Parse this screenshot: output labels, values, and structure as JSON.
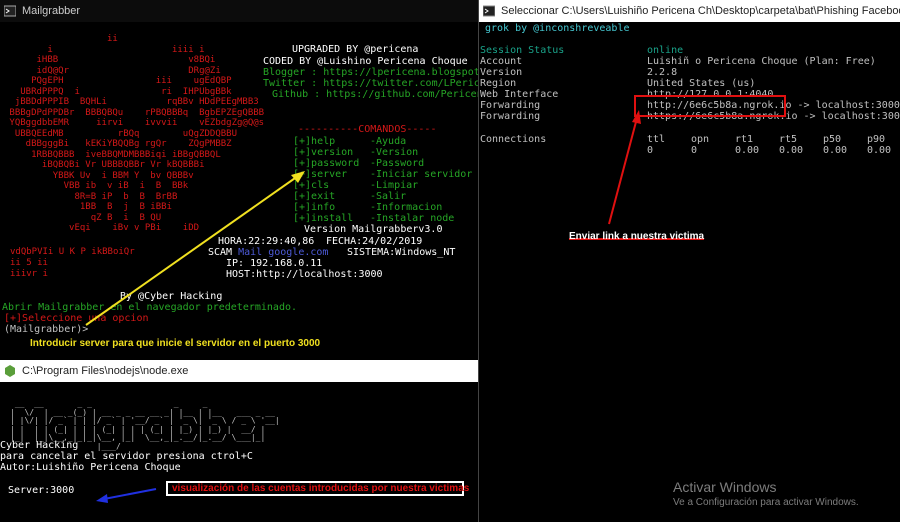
{
  "mailgrabber_window": {
    "title": "Mailgrabber",
    "ascii_art": "                   ii\n        i                      iiii i\n      iHBB                        v8BQi\n      idQ@Qr                      DRg@Zi\n     PQgEPH                 iii    ugEdQBP\n   UBRdPPPQ  i               ri  IHPUbgBBk\n  jBBDdPPPIB  BQHLi           rqBBv HDdPEEgMBB3\n BBBgDPdPPDBr  BBBQBQu    rPBQBBBq  BgbEPZEgQBBB\n YQBggdbbEMR     iirvi    ivvvii    vEZbdgZg@Q@s\n  UBBQEEdMB          rBQq        uQgZDDQBBU\n    dBBgggBi   kEKiYBQQBg rgQr    ZQgPMBBZ\n     1RBBQBBB  iveBBQMDMBBBiqi iBBgQBBQL\n       iBQBQBi Vr UBBBQBBr Vr kBQBBBi\n         YBBK Uv  i BBM Y  bv QBBBv\n           VBB ib  v iB  i  B  BBk\n             8R=B iP  b  B  BrBB\n              1BB  B  j  B iBBi\n                qZ B  i  B QU\n            vEqi    iBv v PBi    iDD",
    "header_lines": [
      {
        "text": "UPGRADED BY @pericena",
        "color": "white"
      },
      {
        "text": "CODED BY  @Luishino Pericena Choque",
        "color": "white"
      },
      {
        "text": "Blogger : https://lpericena.blogspot.com",
        "color": "green"
      },
      {
        "text": "Twitter : https://twitter.com/LPericena",
        "color": "green"
      },
      {
        "text": "Github : https://github.com/Pericena",
        "color": "green"
      }
    ],
    "menu_title": "----------COMANDOS-----",
    "menu": [
      {
        "cmd": "[+]help",
        "desc": "-Ayuda"
      },
      {
        "cmd": "[+]version",
        "desc": "-Version"
      },
      {
        "cmd": "[+]password",
        "desc": "-Password"
      },
      {
        "cmd": "[+]server",
        "desc": "-Iniciar servidor"
      },
      {
        "cmd": "[+]cls",
        "desc": "-Limpiar"
      },
      {
        "cmd": "[+]exit",
        "desc": "-Salir"
      },
      {
        "cmd": "[+]info",
        "desc": "-Informacion"
      },
      {
        "cmd": "[+]install",
        "desc": "-Instalar node"
      }
    ],
    "version": "Version Mailgrabberv3.0",
    "hora": "HORA:22:29:40,86",
    "fecha": "FECHA:24/02/2019",
    "scam_label": "SCAM",
    "scam_link": "Mail google.com",
    "sistema": "SISTEMA:Windows_NT",
    "ip": "IP: 192.168.0.11",
    "host": "HOST:http://localhost:3000",
    "art_tail": [
      "         vdQbPVIi U K P ikBBoiQr",
      "           ii   5   ii",
      "             iiivr i"
    ],
    "by_line": "By  @Cyber Hacking",
    "abrir_line": "  Abrir Mailgrabber en el navegador predeterminado.",
    "select_prompt": "[+]Seleccione una opcion",
    "input_prompt": "(Mailgrabber)>",
    "caption": "Introducir server para que inicie el servidor en el puerto 3000"
  },
  "node_window": {
    "title": "C:\\Program Files\\nodejs\\node.exe",
    "banner": " __  __       _ _                 _     _               \n|  \\/  | __ _(_) | __ _ _ __ __ _| |__ | |__   ___ _ __ \n| |\\/| |/ _` | | |/ _` | '__/ _` | '_ \\| '_ \\ / _ \\ '__|\n| |  | | (_| | | | (_| | | | (_| | |_) | |_) |  __/ |   \n|_|  |_|\\__,_|_|_|\\__, |_|  \\__,_|_.__/|_.__/ \\___|_|   \n                  |___/",
    "sub_lines": [
      "                 Cyber Hacking",
      "  para cancelar el servidor presiona ctrol+C",
      "           Autor:Luishiño Pericena Choque"
    ],
    "server_line": "Server:3000",
    "caption": "visualización de las cuentas introducidas por nuestra victimas"
  },
  "ngrok_window": {
    "title": "Seleccionar C:\\Users\\Luishiño Pericena Ch\\Desktop\\carpeta\\bat\\Phishing Facebook + gmail con Node.js\\Desc",
    "header": "grok by @inconshreveable",
    "rows": [
      {
        "label": "Session Status",
        "value": "online",
        "green": true
      },
      {
        "label": "Account",
        "value": "Luishiñ o Pericena Choque (Plan: Free)"
      },
      {
        "label": "Version",
        "value": "2.2.8"
      },
      {
        "label": "Region",
        "value": "United States (us)"
      },
      {
        "label": "Web Interface",
        "value": "http://127.0.0.1:4040"
      },
      {
        "label": "Forwarding",
        "value": "http://6e6c5b8a.ngrok.io -> localhost:3000"
      },
      {
        "label": "Forwarding",
        "value": "https://6e6c5b8a.ngrok.io -> localhost:3000"
      }
    ],
    "connections_label": "Connections",
    "conn_headers": [
      "ttl",
      "opn",
      "rt1",
      "rt5",
      "p50",
      "p90"
    ],
    "conn_values": [
      "0",
      "0",
      "0.00",
      "0.00",
      "0.00",
      "0.00"
    ],
    "caption": "Enviar link a nuestra victima"
  },
  "activate_windows": {
    "title": "Activar Windows",
    "subtitle": "Ve a Configuración para activar Windows."
  },
  "colors": {
    "red": "#d41818",
    "green": "#26a626",
    "yellow": "#f0e020",
    "annotation_red": "#e01010"
  }
}
